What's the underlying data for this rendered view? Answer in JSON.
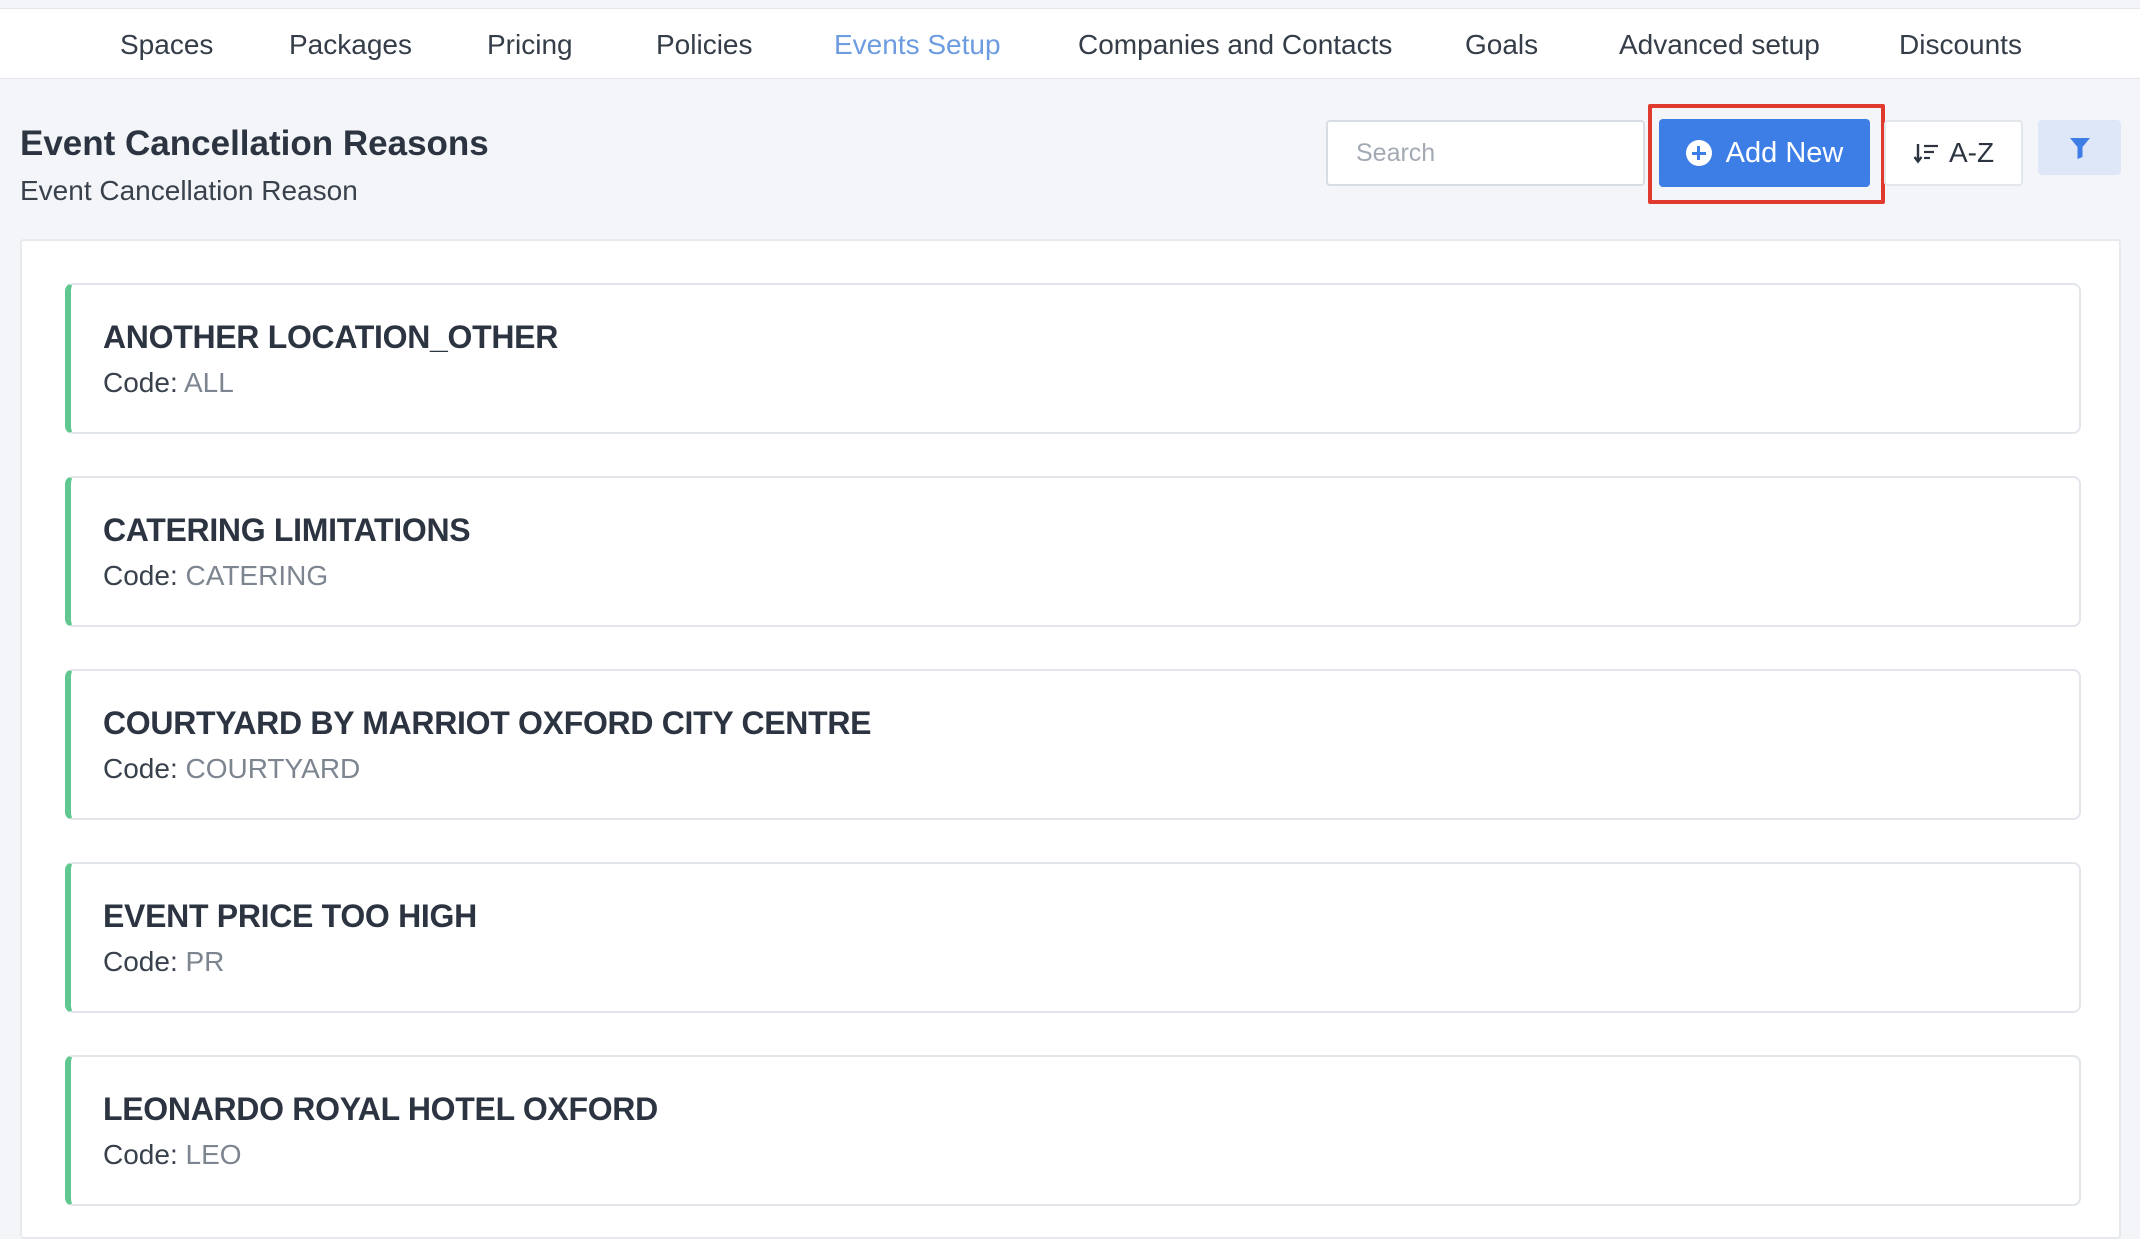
{
  "nav": {
    "tabs": [
      {
        "label": "Spaces",
        "active": false
      },
      {
        "label": "Packages",
        "active": false
      },
      {
        "label": "Pricing",
        "active": false
      },
      {
        "label": "Policies",
        "active": false
      },
      {
        "label": "Events Setup",
        "active": true
      },
      {
        "label": "Companies and Contacts",
        "active": false
      },
      {
        "label": "Goals",
        "active": false
      },
      {
        "label": "Advanced setup",
        "active": false
      },
      {
        "label": "Discounts",
        "active": false
      }
    ]
  },
  "header": {
    "title": "Event Cancellation Reasons",
    "subtitle": "Event Cancellation Reason"
  },
  "toolbar": {
    "search_placeholder": "Search",
    "search_value": "",
    "add_new_label": "Add New",
    "sort_label": "A-Z",
    "sort_icon": "sort-descending-icon",
    "filter_icon": "filter-icon",
    "highlighted_control": "add-new-button"
  },
  "list": {
    "code_prefix": "Code:",
    "items": [
      {
        "name": "ANOTHER LOCATION_OTHER",
        "code": "ALL"
      },
      {
        "name": "CATERING LIMITATIONS",
        "code": "CATERING"
      },
      {
        "name": "COURTYARD BY MARRIOT OXFORD CITY CENTRE",
        "code": "COURTYARD"
      },
      {
        "name": "EVENT PRICE TOO HIGH",
        "code": "PR"
      },
      {
        "name": "LEONARDO ROYAL HOTEL OXFORD",
        "code": "LEO"
      }
    ]
  },
  "colors": {
    "accent": "#3d7ee6",
    "active_tab": "#6e9ce0",
    "card_stripe": "#5fc78f",
    "highlight": "#e03a2e"
  }
}
